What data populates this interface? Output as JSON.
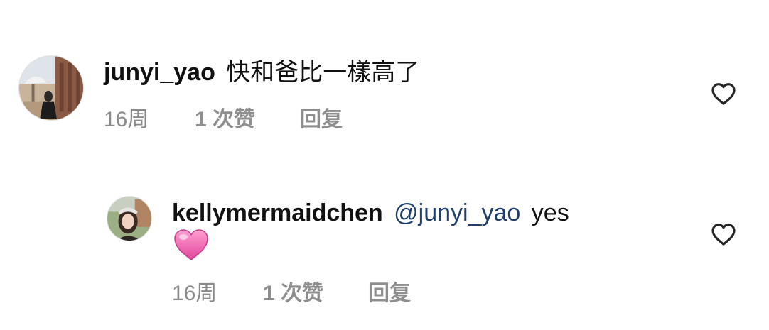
{
  "comments": [
    {
      "username": "junyi_yao",
      "text": "快和爸比一樣高了",
      "time": "16周",
      "likes": "1 次赞",
      "reply_label": "回复",
      "like_icon": "heart-outline-icon"
    },
    {
      "username": "kellymermaidchen",
      "mention": "@junyi_yao",
      "text": "yes",
      "emoji": "pink-heart-emoji",
      "time": "16周",
      "likes": "1 次赞",
      "reply_label": "回复",
      "like_icon": "heart-outline-icon"
    }
  ],
  "colors": {
    "text": "#111111",
    "meta": "#8a8a8a",
    "mention": "#1f3f6e",
    "emoji_heart": "#f06fb3"
  }
}
